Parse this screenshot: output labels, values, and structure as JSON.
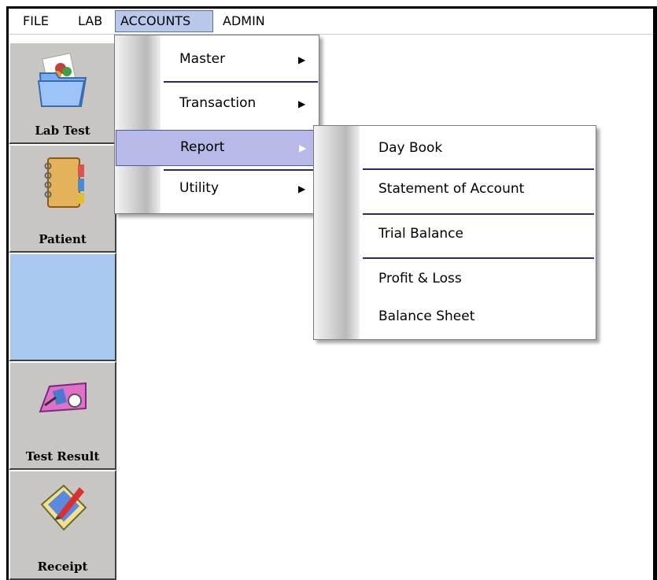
{
  "menubar": {
    "items": [
      "FILE",
      "LAB",
      "ACCOUNTS",
      "ADMIN"
    ]
  },
  "toolbar": {
    "buttons": [
      {
        "label": "Lab Test",
        "icon": "folder-icon"
      },
      {
        "label": "Patient",
        "icon": "notebook-icon"
      },
      {
        "label": "",
        "icon": ""
      },
      {
        "label": "Test Result",
        "icon": "desk-icon"
      },
      {
        "label": "Receipt",
        "icon": "pen-paper-icon"
      }
    ]
  },
  "accounts_menu": {
    "items": [
      "Master",
      "Transaction",
      "Report",
      "Utility"
    ],
    "highlighted": "Report"
  },
  "report_submenu": {
    "items": [
      "Day Book",
      "Statement of Account",
      "Trial Balance",
      "Profit & Loss",
      "Balance Sheet"
    ]
  },
  "colors": {
    "highlight": "#b7b9e8",
    "active_menu": "#b9c8ea",
    "toolbar_blank": "#a9c8f0",
    "separator": "#2a2a6a"
  }
}
